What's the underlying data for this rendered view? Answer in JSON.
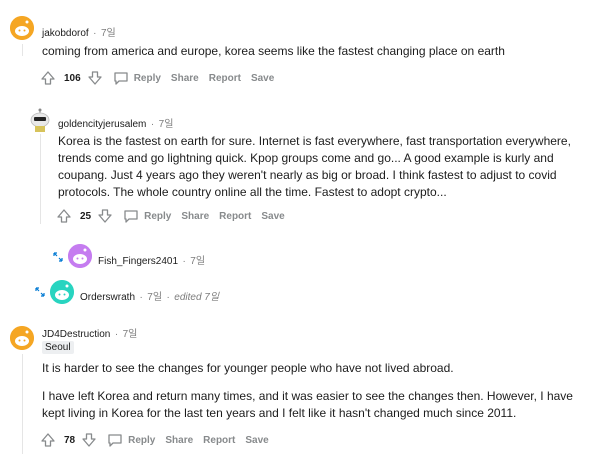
{
  "comments": [
    {
      "username": "jakobdorof",
      "time": "7일",
      "text": "coming from america and europe, korea seems like the fastest changing place on earth",
      "votes": "106",
      "actions": {
        "reply": "Reply",
        "share": "Share",
        "report": "Report",
        "save": "Save"
      }
    },
    {
      "username": "goldencityjerusalem",
      "time": "7일",
      "text": "Korea is the fastest on earth for sure. Internet is fast everywhere, fast transportation everywhere, trends come and go lightning quick. Kpop groups come and go... A good example is kurly and coupang. Just 4 years ago they weren't nearly as big or broad. I think fastest to adjust to covid protocols. The whole country online all the time. Fastest to adopt crypto...",
      "votes": "25",
      "actions": {
        "reply": "Reply",
        "share": "Share",
        "report": "Report",
        "save": "Save"
      }
    },
    {
      "username": "Fish_Fingers2401",
      "time": "7일"
    },
    {
      "username": "Orderswrath",
      "time": "7일",
      "edited": "edited 7일"
    },
    {
      "username": "JD4Destruction",
      "time": "7일",
      "flair": "Seoul",
      "paragraphs": [
        "It is harder to see the changes for younger people who have not lived abroad.",
        "I have left Korea and return many times, and it was easier to see the changes then. However, I have kept living in Korea for the last ten years and I felt like it hasn't changed much since 2011."
      ],
      "votes": "78",
      "actions": {
        "reply": "Reply",
        "share": "Share",
        "report": "Report",
        "save": "Save"
      }
    }
  ],
  "separator": "·",
  "colors": {
    "avatar_orange": "#f5a623",
    "avatar_purple": "#c57cf0",
    "avatar_teal": "#28d4c0",
    "text": "#1c1c1c",
    "meta": "#7c7c7c",
    "action": "#878a8c",
    "link_blue": "#0079d3"
  }
}
